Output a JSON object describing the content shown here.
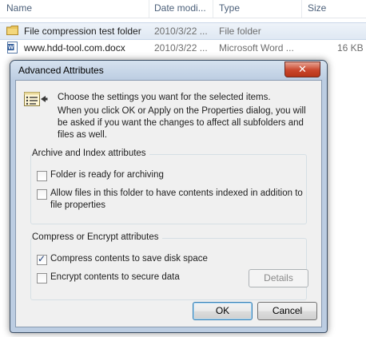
{
  "explorer": {
    "columns": [
      "Name",
      "Date modi...",
      "Type",
      "Size"
    ],
    "files": [
      {
        "name": "File compression test folder",
        "date": "2010/3/22 ...",
        "type": "File folder",
        "size": "",
        "icon": "folder-icon",
        "selected": true
      },
      {
        "name": "www.hdd-tool.com.docx",
        "date": "2010/3/22 ...",
        "type": "Microsoft Word ...",
        "size": "16 KB",
        "icon": "word-document-icon",
        "selected": false
      }
    ]
  },
  "dialog": {
    "title": "Advanced Attributes",
    "close_label": "✕",
    "intro_line1": "Choose the settings you want for the selected items.",
    "intro_line2": "When you click OK or Apply on the Properties dialog, you will be asked if you want the changes to affect all subfolders and files as well.",
    "archive_group": {
      "title": "Archive and Index attributes",
      "folder_ready": {
        "label": "Folder is ready for archiving",
        "checked": false
      },
      "allow_index": {
        "label": "Allow files in this folder to have contents indexed in addition to file properties",
        "checked": false
      }
    },
    "compress_group": {
      "title": "Compress or Encrypt attributes",
      "compress": {
        "label": "Compress contents to save disk space",
        "checked": true
      },
      "encrypt": {
        "label": "Encrypt contents to secure data",
        "checked": false
      },
      "details_label": "Details"
    },
    "ok_label": "OK",
    "cancel_label": "Cancel"
  },
  "colors": {
    "dialog_frame": "#bccde2",
    "close_button": "#c9462c",
    "header_text": "#4c607a"
  }
}
